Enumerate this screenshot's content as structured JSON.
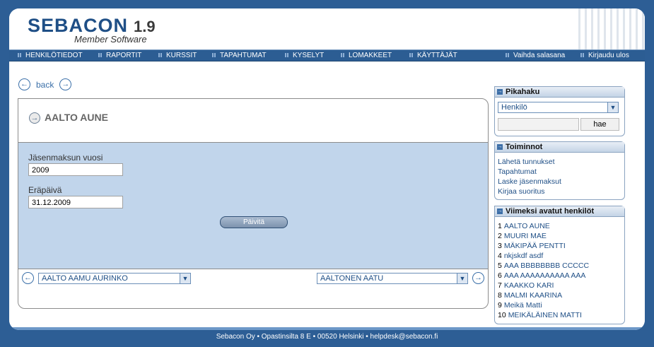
{
  "header": {
    "logo_text": "SEBACON",
    "version": "1.9",
    "subtitle": "Member Software"
  },
  "nav": {
    "items": [
      "HENKILÖTIEDOT",
      "RAPORTIT",
      "KURSSIT",
      "TAPAHTUMAT",
      "KYSELYT",
      "LOMAKKEET",
      "KÄYTTÄJÄT"
    ],
    "right_items": [
      "Vaihda salasana",
      "Kirjaudu ulos"
    ]
  },
  "back": {
    "label": "back"
  },
  "person": {
    "name": "AALTO AUNE"
  },
  "form": {
    "year_label": "Jäsenmaksun vuosi",
    "year_value": "2009",
    "due_label": "Eräpäivä",
    "due_value": "31.12.2009",
    "update_label": "Päivitä"
  },
  "pager": {
    "prev_person": "AALTO AAMU AURINKO",
    "next_person": "AALTONEN AATU"
  },
  "quicksearch": {
    "title": "Pikahaku",
    "selected": "Henkilö",
    "button": "hae"
  },
  "actions": {
    "title": "Toiminnot",
    "items": [
      "Lähetä tunnukset",
      "Tapahtumat",
      "Laske jäsenmaksut",
      "Kirjaa suoritus"
    ]
  },
  "recent": {
    "title": "Viimeksi avatut henkilöt",
    "items": [
      {
        "num": "1",
        "name": "AALTO AUNE"
      },
      {
        "num": "2",
        "name": "MUURI MAE"
      },
      {
        "num": "3",
        "name": "MÄKIPÄÄ PENTTI"
      },
      {
        "num": "4",
        "name": "nkjskdf asdf"
      },
      {
        "num": "5",
        "name": "AAA BBBBBBBB CCCCC"
      },
      {
        "num": "6",
        "name": "AAA AAAAAAAAAA AAA"
      },
      {
        "num": "7",
        "name": "KAAKKO KARI"
      },
      {
        "num": "8",
        "name": "MALMI KAARINA"
      },
      {
        "num": "9",
        "name": "Meikä Matti"
      },
      {
        "num": "10",
        "name": "MEIKÄLÄINEN MATTI"
      }
    ]
  },
  "footer": {
    "text": "Sebacon Oy • Opastinsilta 8 E • 00520 Helsinki • helpdesk@sebacon.fi"
  }
}
